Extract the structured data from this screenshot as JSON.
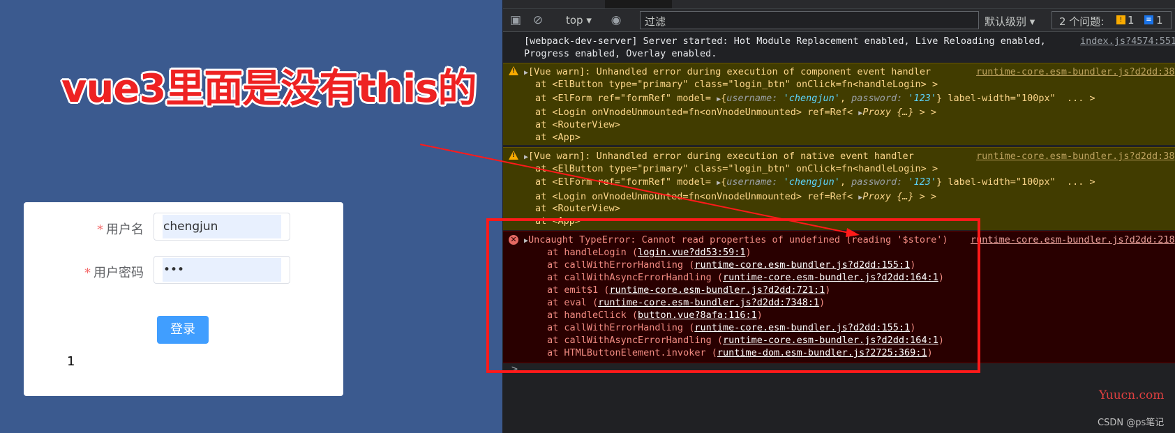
{
  "annotation": {
    "headline": "vue3里面是没有this的"
  },
  "login_form": {
    "username_label": "用户名",
    "username_value": "chengjun",
    "password_label": "用户密码",
    "password_value": "•••",
    "required_mark": "*",
    "submit_label": "登录",
    "counter_value": "1"
  },
  "devtools": {
    "context_selector": "top",
    "filter_placeholder": "过滤",
    "log_level": "默认级别",
    "issues_label": "2 个问题:",
    "issues_warnings": "1",
    "issues_info": "1",
    "info_message": {
      "line1": "[webpack-dev-server] Server started: Hot Module Replacement enabled, Live Reloading enabled,",
      "line2": "Progress enabled, Overlay enabled.",
      "source": "index.js?4574:551"
    },
    "warning1": {
      "title": "[Vue warn]: Unhandled error during execution of component event handler",
      "source": "runtime-core.esm-bundler.js?d2dd:38",
      "frame1": "at <ElButton type=\"primary\" class=\"login_btn\" onClick=fn<handleLogin> >",
      "frame2_prefix": "at <ElForm ref=\"formRef\" model= ",
      "frame2_obj_username_key": "username",
      "frame2_obj_username_val": "'chengjun'",
      "frame2_obj_password_key": "password",
      "frame2_obj_password_val": "'123'",
      "frame2_suffix": " label-width=\"100px\"  ... >",
      "frame3_prefix": "at <Login onVnodeUnmounted=fn<onVnodeUnmounted> ref=Ref< ",
      "frame3_proxy": "Proxy {…}",
      "frame3_suffix": " > >",
      "frame4": "at <RouterView>",
      "frame5": "at <App>"
    },
    "warning2": {
      "title": "[Vue warn]: Unhandled error during execution of native event handler",
      "source": "runtime-core.esm-bundler.js?d2dd:38",
      "frame1": "at <ElButton type=\"primary\" class=\"login_btn\" onClick=fn<handleLogin> >",
      "frame2_prefix": "at <ElForm ref=\"formRef\" model= ",
      "frame2_obj_username_key": "username",
      "frame2_obj_username_val": "'chengjun'",
      "frame2_obj_password_key": "password",
      "frame2_obj_password_val": "'123'",
      "frame2_suffix": " label-width=\"100px\"  ... >",
      "frame3_prefix": "at <Login onVnodeUnmounted=fn<onVnodeUnmounted> ref=Ref< ",
      "frame3_proxy": "Proxy {…}",
      "frame3_suffix": " > >",
      "frame4": "at <RouterView>",
      "frame5": "at <App>"
    },
    "error": {
      "title": "Uncaught TypeError: Cannot read properties of undefined (reading '$store')",
      "source": "runtime-core.esm-bundler.js?d2dd:218",
      "frames": [
        {
          "fn": "at handleLogin (",
          "loc": "login.vue?dd53:59:1"
        },
        {
          "fn": "at callWithErrorHandling (",
          "loc": "runtime-core.esm-bundler.js?d2dd:155:1"
        },
        {
          "fn": "at callWithAsyncErrorHandling (",
          "loc": "runtime-core.esm-bundler.js?d2dd:164:1"
        },
        {
          "fn": "at emit$1 (",
          "loc": "runtime-core.esm-bundler.js?d2dd:721:1"
        },
        {
          "fn": "at eval (",
          "loc": "runtime-core.esm-bundler.js?d2dd:7348:1"
        },
        {
          "fn": "at handleClick (",
          "loc": "button.vue?8afa:116:1"
        },
        {
          "fn": "at callWithErrorHandling (",
          "loc": "runtime-core.esm-bundler.js?d2dd:155:1"
        },
        {
          "fn": "at callWithAsyncErrorHandling (",
          "loc": "runtime-core.esm-bundler.js?d2dd:164:1"
        },
        {
          "fn": "at HTMLButtonElement.invoker (",
          "loc": "runtime-dom.esm-bundler.js?2725:369:1"
        }
      ]
    },
    "prompt_symbol": ">"
  },
  "watermarks": {
    "site": "Yuucn.com",
    "csdn": "CSDN @ps笔记"
  },
  "colors": {
    "left_bg": "#3b5a8f",
    "headline": "#ee2222",
    "primary_button": "#409eff",
    "highlight": "#ff1a1a"
  }
}
